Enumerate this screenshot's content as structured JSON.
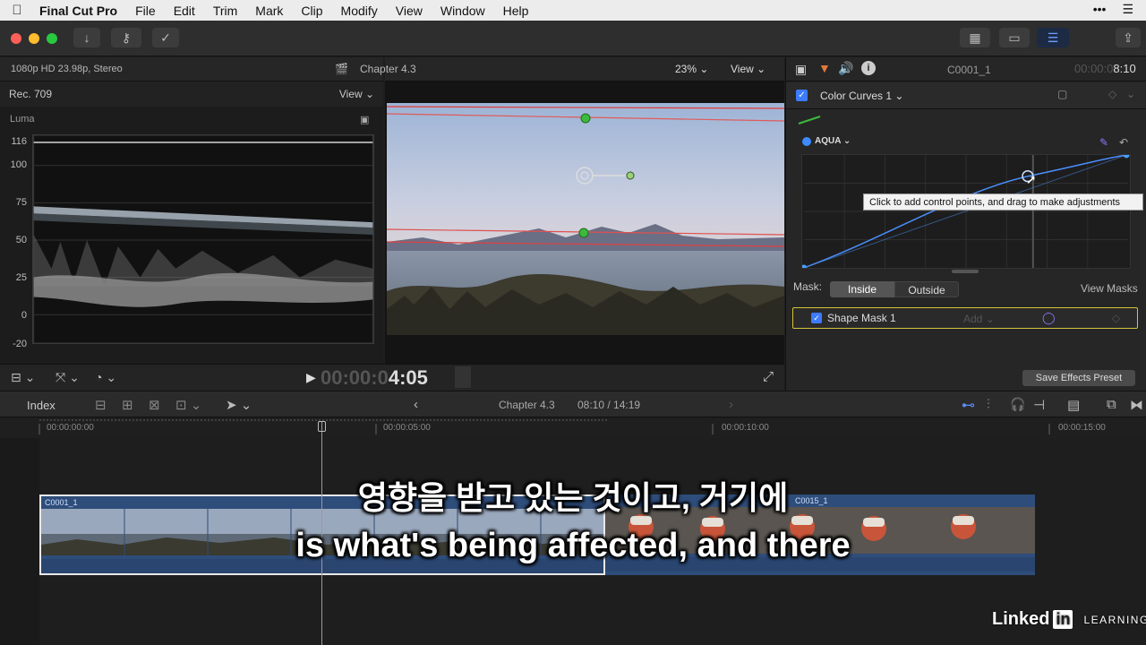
{
  "menubar": {
    "apple": "",
    "app_name": "Final Cut Pro",
    "items": [
      "File",
      "Edit",
      "Trim",
      "Mark",
      "Clip",
      "Modify",
      "View",
      "Window",
      "Help"
    ]
  },
  "scopes": {
    "format": "1080p HD 23.98p, Stereo",
    "colorspace": "Rec. 709",
    "view_label": "View",
    "luma_label": "Luma",
    "y_labels": [
      "116",
      "100",
      "75",
      "50",
      "25",
      "0",
      "-20"
    ]
  },
  "viewer": {
    "title": "Chapter 4.3",
    "zoom": "23%",
    "view_label": "View",
    "timecode_dim": "00:00:0",
    "timecode_bright": "4:05"
  },
  "inspector": {
    "clip_name": "C0001_1",
    "duration_dim": "00:00:0",
    "duration_bright": "8:10",
    "effect_name": "Color Curves 1",
    "curve_channel": "AQUA",
    "tooltip": "Click to add control points, and drag to make adjustments",
    "mask_label": "Mask:",
    "mask_inside": "Inside",
    "mask_outside": "Outside",
    "view_masks": "View Masks",
    "shape_mask": "Shape Mask 1",
    "add_label": "Add",
    "save_preset": "Save Effects Preset"
  },
  "timeline": {
    "index_label": "Index",
    "project": "Chapter 4.3",
    "position": "08:10 / 14:19",
    "ruler": [
      "00:00:00:00",
      "00:00:05:00",
      "00:00:10:00",
      "00:00:15:00"
    ],
    "clips": [
      {
        "name": "C0001_1"
      },
      {
        "name": "C0015_1"
      }
    ]
  },
  "subtitles": {
    "korean": "영향을 받고 있는 것이고, 거기에",
    "english": "is what's being affected, and there"
  },
  "watermark": {
    "linked": "Linked",
    "in": "in",
    "learning": "LEARNING"
  },
  "colors": {
    "accent": "#3d7bff",
    "mask_outline": "#d8c23a",
    "clip_blue": "#2e4d7a"
  }
}
